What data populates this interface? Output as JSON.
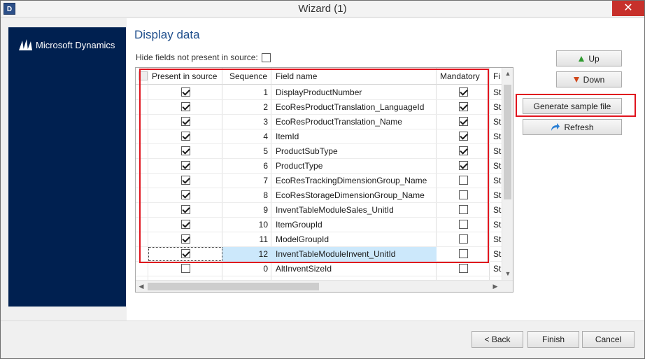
{
  "window": {
    "title": "Wizard (1)",
    "close_glyph": "✕",
    "app_icon_text": "D"
  },
  "banner": {
    "brand": "Microsoft Dynamics",
    "logo_icon": "dynamics-logo-icon"
  },
  "page": {
    "heading": "Display data",
    "hide_fields_label": "Hide fields not present in source:",
    "hide_fields_checked": false
  },
  "grid": {
    "columns": [
      "Present in source",
      "Sequence",
      "Field name",
      "Mandatory",
      "Fi"
    ],
    "rows": [
      {
        "present": true,
        "sequence": "1",
        "field": "DisplayProductNumber",
        "mandatory": true,
        "fi": "St"
      },
      {
        "present": true,
        "sequence": "2",
        "field": "EcoResProductTranslation_LanguageId",
        "mandatory": true,
        "fi": "St"
      },
      {
        "present": true,
        "sequence": "3",
        "field": "EcoResProductTranslation_Name",
        "mandatory": true,
        "fi": "St"
      },
      {
        "present": true,
        "sequence": "4",
        "field": "ItemId",
        "mandatory": true,
        "fi": "St"
      },
      {
        "present": true,
        "sequence": "5",
        "field": "ProductSubType",
        "mandatory": true,
        "fi": "St"
      },
      {
        "present": true,
        "sequence": "6",
        "field": "ProductType",
        "mandatory": true,
        "fi": "St"
      },
      {
        "present": true,
        "sequence": "7",
        "field": "EcoResTrackingDimensionGroup_Name",
        "mandatory": false,
        "fi": "St"
      },
      {
        "present": true,
        "sequence": "8",
        "field": "EcoResStorageDimensionGroup_Name",
        "mandatory": false,
        "fi": "St"
      },
      {
        "present": true,
        "sequence": "9",
        "field": "InventTableModuleSales_UnitId",
        "mandatory": false,
        "fi": "St"
      },
      {
        "present": true,
        "sequence": "10",
        "field": "ItemGroupId",
        "mandatory": false,
        "fi": "St"
      },
      {
        "present": true,
        "sequence": "11",
        "field": "ModelGroupId",
        "mandatory": false,
        "fi": "St"
      },
      {
        "present": true,
        "sequence": "12",
        "field": "InventTableModuleInvent_UnitId",
        "mandatory": false,
        "fi": "St",
        "selected": true
      },
      {
        "present": false,
        "sequence": "0",
        "field": "AltInventSizeId",
        "mandatory": false,
        "fi": "St"
      }
    ]
  },
  "side_buttons": {
    "up": "Up",
    "down": "Down",
    "generate": "Generate sample file",
    "refresh": "Refresh"
  },
  "footer": {
    "back": "< Back",
    "finish": "Finish",
    "cancel": "Cancel"
  },
  "colors": {
    "banner": "#002050",
    "heading": "#1e4e8c",
    "highlight": "#e0141e",
    "selection": "#cce8fb"
  }
}
